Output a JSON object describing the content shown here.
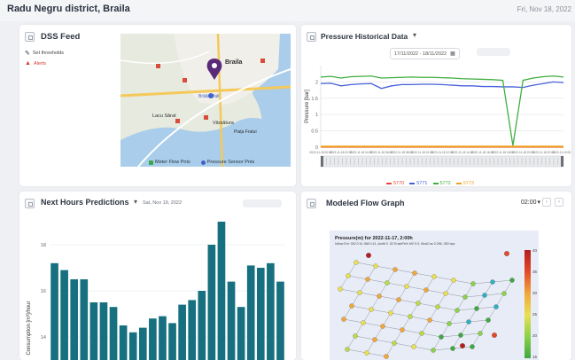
{
  "header": {
    "district": "Radu Negru district, Braila",
    "date": "Fri, Nov 18, 2022"
  },
  "dss": {
    "title": "DSS Feed",
    "set_thresholds": "Set thresholds",
    "alerts": "Alerts",
    "map_labels": {
      "braila": "Braila",
      "lacu_sarat": "Lacu Sărat",
      "varsatura": "Vărsătura",
      "insula": "Brăila Mall",
      "piata": "Piața Fratui"
    },
    "legend": [
      {
        "label": "Meter Flow Pnts",
        "color": "#3aa84a"
      },
      {
        "label": "Pressure Sensor Pnts",
        "color": "#4262c8"
      }
    ]
  },
  "pressure": {
    "title": "Pressure Historical Data",
    "date_range": "17/11/2022 - 18/11/2022",
    "colors": {
      "s5770": "#e8493a",
      "s5771": "#4760d8",
      "s5772": "#3fae3f",
      "s5773": "#f0a020"
    },
    "legend": [
      {
        "label": "5770",
        "color": "#e8493a"
      },
      {
        "label": "5771",
        "color": "#4760d8"
      },
      {
        "label": "5772",
        "color": "#3fae3f"
      },
      {
        "label": "5773",
        "color": "#f0a020"
      }
    ]
  },
  "chart_data": {
    "type": "line",
    "ylabel": "Pressure [bar]",
    "ylim": [
      0,
      2.5
    ],
    "yticks": [
      "0",
      "0.5",
      "1",
      "1.5",
      "2"
    ],
    "xticks": [
      "2022-11-18 00:00",
      "2022-11-18 02:00",
      "2022-11-18 04:00",
      "2022-11-18 06:00",
      "2022-11-18 08:00",
      "2022-11-18 10:00",
      "2022-11-18 12:00",
      "2022-11-18 14:00",
      "2022-11-18 16:00",
      "2022-11-18 18:00",
      "2022-11-18 20:00",
      "2022-11-18 22:00",
      "2022-11-19 00:00"
    ],
    "series": [
      {
        "name": "5770",
        "values": [
          0,
          0,
          0,
          0,
          0,
          0,
          0,
          0,
          0,
          0,
          0,
          0,
          0,
          0,
          0,
          0,
          0,
          0,
          0,
          0,
          0,
          0,
          0,
          0,
          0
        ]
      },
      {
        "name": "5771",
        "values": [
          1.95,
          1.96,
          1.88,
          1.92,
          1.94,
          1.95,
          1.8,
          1.88,
          1.92,
          1.92,
          1.93,
          1.93,
          1.92,
          1.9,
          1.88,
          1.88,
          1.86,
          1.86,
          1.85,
          1.85,
          1.83,
          1.9,
          1.95,
          2.0,
          1.98
        ]
      },
      {
        "name": "5772",
        "values": [
          2.15,
          2.17,
          2.12,
          2.16,
          2.17,
          2.18,
          2.12,
          2.13,
          2.14,
          2.15,
          2.14,
          2.14,
          2.13,
          2.12,
          2.1,
          2.09,
          2.08,
          2.07,
          2.05,
          0.05,
          2.05,
          2.12,
          2.16,
          2.18,
          2.15
        ]
      },
      {
        "name": "5773",
        "values": [
          0.02,
          0.02,
          0.02,
          0.02,
          0.02,
          0.02,
          0.02,
          0.02,
          0.02,
          0.02,
          0.02,
          0.02,
          0.02,
          0.02,
          0.02,
          0.02,
          0.02,
          0.02,
          0.02,
          0.02,
          0.02,
          0.02,
          0.02,
          0.02,
          0.02
        ]
      }
    ]
  },
  "predictions": {
    "title": "Next Hours Predictions",
    "date": "Sat, Nov 19, 2022",
    "ylabel": "Consumption [m³]/hour",
    "yticks": [
      "14",
      "16",
      "18"
    ],
    "ylim": [
      13,
      19
    ],
    "values": [
      17.2,
      16.9,
      16.5,
      16.5,
      15.5,
      15.5,
      15.3,
      14.5,
      14.2,
      14.4,
      14.8,
      14.9,
      14.6,
      15.4,
      15.6,
      16.0,
      18.0,
      19.0,
      16.4,
      15.3,
      17.1,
      17.0,
      17.2,
      16.4
    ]
  },
  "flow": {
    "title": "Modeled Flow Graph",
    "time_value": "02:00",
    "graph_title": "Pressure(m) for 2022-11-17, 2:00h",
    "graph_subtitle": "Inflow Ext: 352.0 M, 388 0.41, Avrilit 0 .52 EnabPs% MV 5 0, ModCus 0.296, 350 bps",
    "colorbar_ticks": [
      "40",
      "35",
      "30",
      "25",
      "20",
      "15"
    ]
  }
}
